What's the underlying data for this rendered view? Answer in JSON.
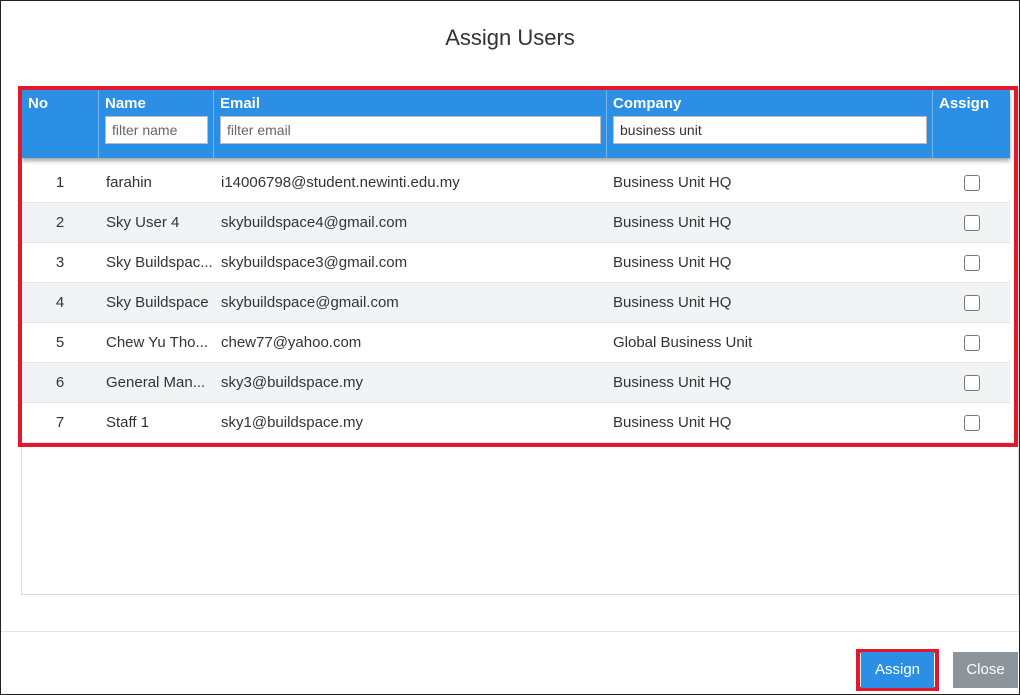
{
  "dialog": {
    "title": "Assign Users"
  },
  "table": {
    "headers": {
      "no": "No",
      "name": "Name",
      "email": "Email",
      "company": "Company",
      "assign": "Assign"
    },
    "filters": {
      "name": {
        "value": "",
        "placeholder": "filter name"
      },
      "email": {
        "value": "",
        "placeholder": "filter email"
      },
      "company": {
        "value": "business unit",
        "placeholder": ""
      }
    },
    "rows": [
      {
        "no": "1",
        "name": "farahin",
        "email": "i14006798@student.newinti.edu.my",
        "company": "Business Unit HQ",
        "assigned": false
      },
      {
        "no": "2",
        "name": "Sky User 4",
        "email": "skybuildspace4@gmail.com",
        "company": "Business Unit HQ",
        "assigned": false
      },
      {
        "no": "3",
        "name": "Sky Buildspac...",
        "email": "skybuildspace3@gmail.com",
        "company": "Business Unit HQ",
        "assigned": false
      },
      {
        "no": "4",
        "name": "Sky Buildspace",
        "email": "skybuildspace@gmail.com",
        "company": "Business Unit HQ",
        "assigned": false
      },
      {
        "no": "5",
        "name": "Chew Yu Tho...",
        "email": "chew77@yahoo.com",
        "company": "Global Business Unit",
        "assigned": false
      },
      {
        "no": "6",
        "name": "General Man...",
        "email": "sky3@buildspace.my",
        "company": "Business Unit HQ",
        "assigned": false
      },
      {
        "no": "7",
        "name": "Staff 1",
        "email": "sky1@buildspace.my",
        "company": "Business Unit HQ",
        "assigned": false
      }
    ]
  },
  "footer": {
    "assign_label": "Assign",
    "close_label": "Close"
  },
  "colors": {
    "header_bg": "#2b8fe6",
    "highlight": "#e3182d",
    "close_bg": "#8d959c"
  }
}
